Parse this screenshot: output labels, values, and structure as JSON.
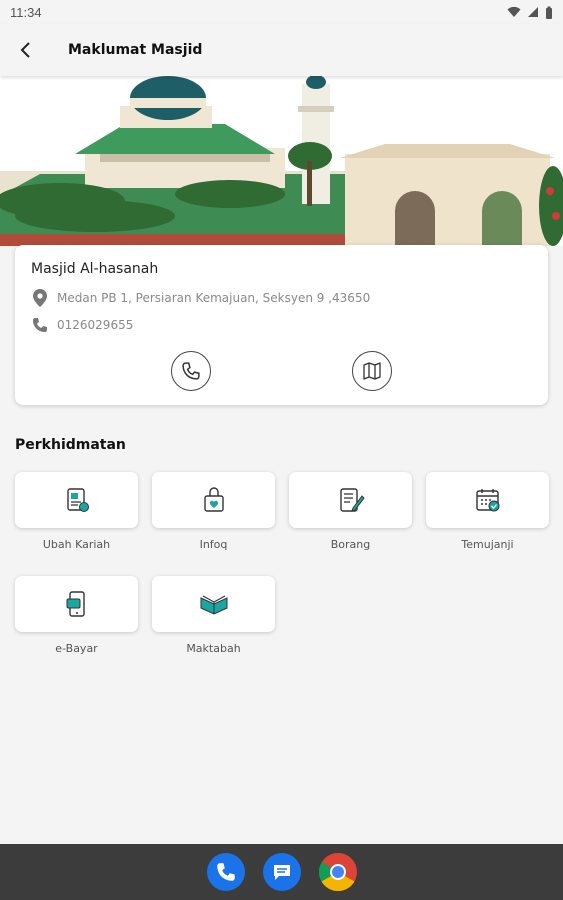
{
  "status_bar": {
    "time": "11:34"
  },
  "app_bar": {
    "title": "Maklumat Masjid"
  },
  "mosque": {
    "name": "Masjid Al-hasanah",
    "address": "Medan PB 1, Persiaran Kemajuan, Seksyen 9  ,43650",
    "phone": "0126029655"
  },
  "services": {
    "title": "Perkhidmatan",
    "items": [
      {
        "label": "Ubah Kariah",
        "icon": "document-edit-icon"
      },
      {
        "label": "Infoq",
        "icon": "donation-box-icon"
      },
      {
        "label": "Borang",
        "icon": "form-pen-icon"
      },
      {
        "label": "Temujanji",
        "icon": "calendar-check-icon"
      },
      {
        "label": "e-Bayar",
        "icon": "mobile-payment-icon"
      },
      {
        "label": "Maktabah",
        "icon": "open-book-icon"
      }
    ]
  },
  "colors": {
    "accent": "#1aa7a1",
    "background": "#f4f4f4",
    "nav_bar": "#3c3c3c"
  },
  "dock": [
    "phone-app-icon",
    "messages-app-icon",
    "chrome-app-icon"
  ]
}
